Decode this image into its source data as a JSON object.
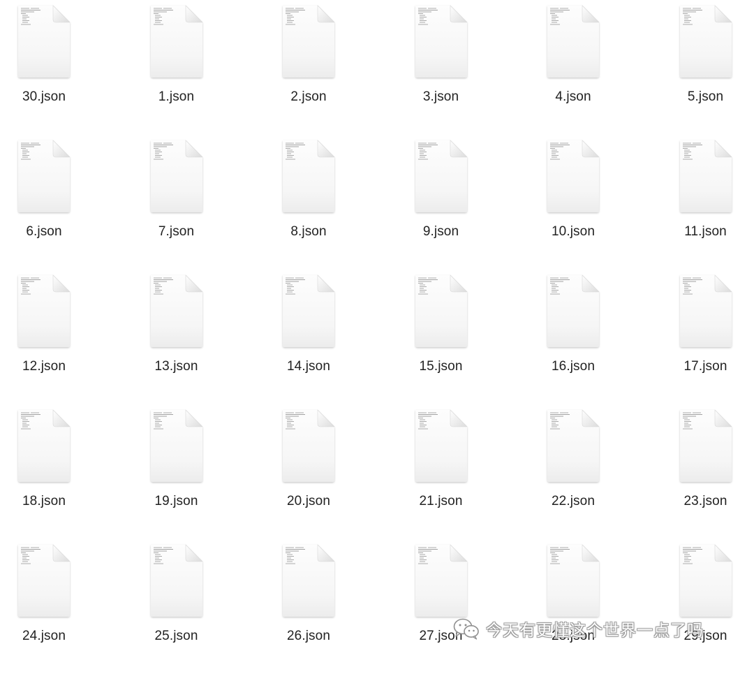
{
  "colors": {
    "page_background": "#ffffff",
    "file_label": "#222222",
    "paper_light": "#fbfbfb",
    "paper_shadow": "#e6e6e6",
    "fold": "#f0f0f0",
    "preview_lines": "#9a9a9a"
  },
  "file_icon_name": "json-document-icon",
  "files": [
    {
      "name": "30.json"
    },
    {
      "name": "1.json"
    },
    {
      "name": "2.json"
    },
    {
      "name": "3.json"
    },
    {
      "name": "4.json"
    },
    {
      "name": "5.json"
    },
    {
      "name": "6.json"
    },
    {
      "name": "7.json"
    },
    {
      "name": "8.json"
    },
    {
      "name": "9.json"
    },
    {
      "name": "10.json"
    },
    {
      "name": "11.json"
    },
    {
      "name": "12.json"
    },
    {
      "name": "13.json"
    },
    {
      "name": "14.json"
    },
    {
      "name": "15.json"
    },
    {
      "name": "16.json"
    },
    {
      "name": "17.json"
    },
    {
      "name": "18.json"
    },
    {
      "name": "19.json"
    },
    {
      "name": "20.json"
    },
    {
      "name": "21.json"
    },
    {
      "name": "22.json"
    },
    {
      "name": "23.json"
    },
    {
      "name": "24.json"
    },
    {
      "name": "25.json"
    },
    {
      "name": "26.json"
    },
    {
      "name": "27.json"
    },
    {
      "name": "28.json"
    },
    {
      "name": "29.json"
    }
  ],
  "watermark": {
    "icon": "wechat-logo-icon",
    "text": "今天有更懂这个世界一点了吗"
  }
}
